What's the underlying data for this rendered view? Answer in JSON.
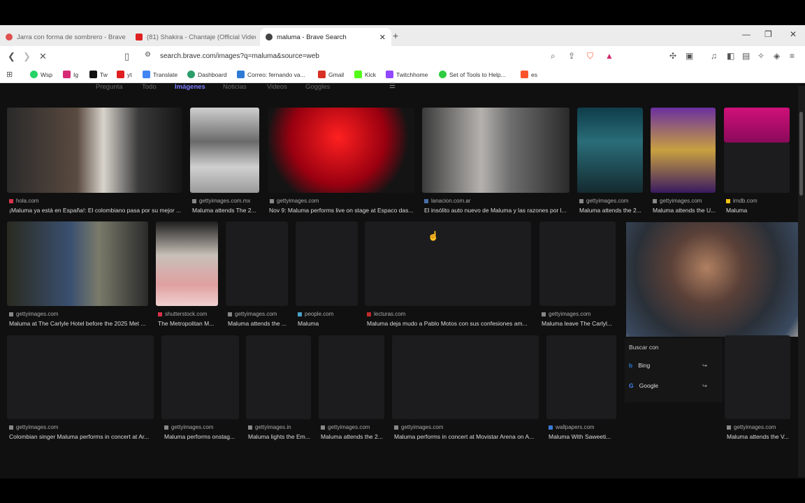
{
  "tabs": [
    {
      "label": "Jarra con forma de sombrero - Brave",
      "active": false,
      "color": "#e05050"
    },
    {
      "label": "(81) Shakira - Chantaje (Official Video",
      "active": false,
      "color": "#e02020"
    },
    {
      "label": "maluma - Brave Search",
      "active": true,
      "color": "#444444"
    }
  ],
  "address_url": "search.brave.com/images?q=maluma&source=web",
  "bookmarks": [
    {
      "label": "Wsp",
      "icon": "whatsapp-icon",
      "color": "#25d366"
    },
    {
      "label": "Ig",
      "icon": "instagram-icon",
      "color": "#d62976"
    },
    {
      "label": "Tw",
      "icon": "x-icon",
      "color": "#111111"
    },
    {
      "label": "yt",
      "icon": "youtube-icon",
      "color": "#e02020"
    },
    {
      "label": "Translate",
      "icon": "translate-icon",
      "color": "#4285f4"
    },
    {
      "label": "Dashboard",
      "icon": "dashboard-icon",
      "color": "#2a9d6a"
    },
    {
      "label": "Correo: fernando va...",
      "icon": "outlook-icon",
      "color": "#2d7ad6"
    },
    {
      "label": "Gmail",
      "icon": "gmail-icon",
      "color": "#d93025"
    },
    {
      "label": "Kick",
      "icon": "kick-icon",
      "color": "#53fc18"
    },
    {
      "label": "Twitchhome",
      "icon": "twitch-icon",
      "color": "#9146ff"
    },
    {
      "label": "Set of Tools to Help...",
      "icon": "check-circle-icon",
      "color": "#2ecc40"
    },
    {
      "label": "es",
      "icon": "brave-icon",
      "color": "#fb542b"
    }
  ],
  "page_tabs": [
    "Pregunta",
    "Todo",
    "Imágenes",
    "Noticias",
    "Videos",
    "Goggles"
  ],
  "row1": [
    {
      "source": "hola.com",
      "caption": "¡Maluma ya está en España!: El colombiano pasa por su mejor ..."
    },
    {
      "source": "gettyimages.com.mx",
      "caption": "Maluma attends The 2..."
    },
    {
      "source": "gettyimages.com",
      "caption": "Nov 9: Maluma performs live on stage at Espaco das..."
    },
    {
      "source": "lanacion.com.ar",
      "caption": "El insólito auto nuevo de Maluma y las razones por l..."
    },
    {
      "source": "gettyimages.com",
      "caption": "Maluma attends the 2..."
    },
    {
      "source": "gettyimages.com",
      "caption": "Maluma attends the U..."
    },
    {
      "source": "imdb.com",
      "caption": "Maluma"
    }
  ],
  "row2": [
    {
      "source": "gettyimages.com",
      "caption": "Maluma at The Carlyle Hotel before the 2025 Met ..."
    },
    {
      "source": "shutterstock.com",
      "caption": "The Metropolitan M..."
    },
    {
      "source": "gettyimages.com",
      "caption": "Maluma attends the ..."
    },
    {
      "source": "people.com",
      "caption": "Maluma"
    },
    {
      "source": "lecturas.com",
      "caption": "Maluma deja mudo a Pablo Motos con sus confesiones am..."
    },
    {
      "source": "gettyimages.com",
      "caption": "Maluma leave The Carlyl..."
    }
  ],
  "row3": [
    {
      "source": "gettyimages.com",
      "caption": "Colombian singer Maluma performs in concert at Ar..."
    },
    {
      "source": "gettyimages.com",
      "caption": "Maluma performs onstag..."
    },
    {
      "source": "gettyimages.in",
      "caption": "Maluma lights the Em..."
    },
    {
      "source": "gettyimages.com",
      "caption": "Maluma attends the 2..."
    },
    {
      "source": "gettyimages.com",
      "caption": "Maluma performs in concert at Movistar Arena on A..."
    },
    {
      "source": "wallpapers.com",
      "caption": "Maluma With Saweeti..."
    },
    {
      "source": "gettyimages.com",
      "caption": "Maluma attends the V..."
    }
  ],
  "search_with": {
    "title": "Buscar con",
    "options": [
      {
        "label": "Bing",
        "icon": "bing-icon",
        "color": "#2b7cd3"
      },
      {
        "label": "Google",
        "icon": "google-icon",
        "color": "#4285f4"
      }
    ]
  },
  "colors": {
    "page_bg": "#101010",
    "active_tab": "#7d7dff",
    "chrome": "#ececec"
  }
}
